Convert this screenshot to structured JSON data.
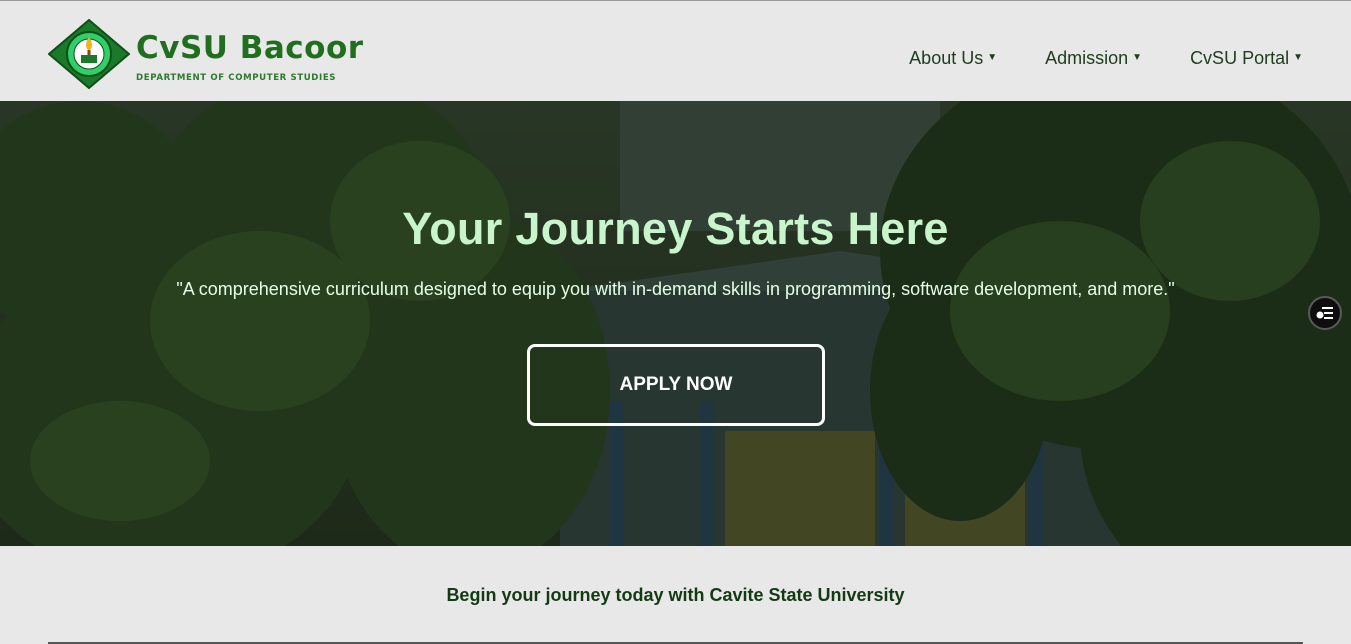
{
  "header": {
    "brand_name": "CvSU Bacoor",
    "brand_subtitle": "DEPARTMENT OF COMPUTER STUDIES",
    "nav": [
      {
        "label": "About Us"
      },
      {
        "label": "Admission"
      },
      {
        "label": "CvSU Portal"
      }
    ]
  },
  "hero": {
    "title": "Your Journey Starts Here",
    "quote": "\"A comprehensive curriculum designed to equip you with in-demand skills in programming, software development, and more.\"",
    "cta_label": "APPLY NOW"
  },
  "bottom": {
    "text": "Begin your journey today with Cavite State University"
  },
  "icons": {
    "nav_caret": "caret-down-icon",
    "floating": "accessibility-menu-icon",
    "logo": "university-seal-icon"
  },
  "colors": {
    "brand_green": "#1f6f1f",
    "hero_title": "#c8f5cc",
    "header_bg": "#e8e8e8",
    "nav_text": "#1d3d1d"
  }
}
